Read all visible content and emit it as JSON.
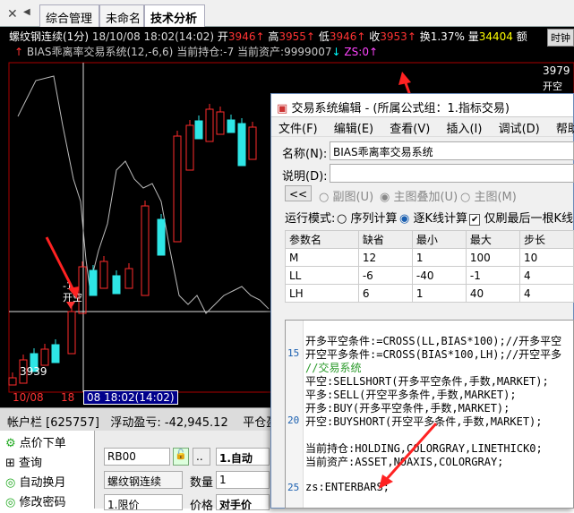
{
  "tabs": [
    "综合管理",
    "未命名",
    "技术分析"
  ],
  "chart": {
    "symbol": "螺纹钢连续(1分)",
    "datetime": "18/10/08 18:02(14:02)",
    "open_label": "开",
    "open": "3946",
    "high_label": "高",
    "high": "3955",
    "low_label": "低",
    "low": "3946",
    "close_label": "收",
    "close": "3953",
    "turnover_label": "换",
    "turnover": "1.37%",
    "volume_label": "量",
    "volume": "34404",
    "amount_label": "额",
    "time_button": "时钟",
    "indicator_line": "BIAS乖离率交易系统(12,-6,6)",
    "holding_label": "当前持仓:",
    "holding": "-7",
    "asset_label": "当前资产:",
    "asset": "9999007",
    "zs_label": "ZS:",
    "zs": "0",
    "price_top": "3979",
    "price_bottom": "3939",
    "signal_top": "开空",
    "signal_left_num": "-1",
    "signal_left": "开空",
    "axis_left": "10/08",
    "axis_mid": "18",
    "axis_cursor": "08 18:02(14:02)",
    "colors": {
      "up": "#ff2b2b",
      "down": "#2ee6e6",
      "bg": "#000000"
    }
  },
  "account_bar": {
    "label": "帐户栏",
    "account": "[625757]",
    "pnl_label": "浮动盈亏:",
    "pnl": "-42,945.12",
    "close_label": "平仓盈"
  },
  "left_menu": [
    "点价下单",
    "查询",
    "自动换月",
    "修改密码"
  ],
  "order": {
    "code": "RB00",
    "dots": "..",
    "mode": "1.自动",
    "name": "螺纹钢连续",
    "qty_label": "数量",
    "qty": "1",
    "price_type": "1.限价",
    "price_label": "价格",
    "price": "对手价"
  },
  "dialog": {
    "title": "交易系统编辑 - (所属公式组：1.指标交易)",
    "menus": [
      "文件(F)",
      "编辑(E)",
      "查看(V)",
      "插入(I)",
      "调试(D)",
      "帮助(H)"
    ],
    "name_label": "名称(N):",
    "name_value": "BIAS乖离率交易系统",
    "desc_label": "说明(D):",
    "back_button": "<<",
    "mode_fig": "副图(U)",
    "mode_overlay": "主图叠加(U)",
    "mode_main": "主图(M)",
    "run_label": "运行模式:",
    "run_seq": "序列计算",
    "run_bar": "逐K线计算",
    "refresh_last": "仅刷最后一根K线",
    "param_headers": [
      "参数名",
      "缺省",
      "最小",
      "最大",
      "步长"
    ],
    "params": [
      [
        "M",
        "12",
        "1",
        "100",
        "10"
      ],
      [
        "LL",
        "-6",
        "-40",
        "-1",
        "4"
      ],
      [
        "LH",
        "6",
        "1",
        "40",
        "4"
      ]
    ],
    "code_lines": [
      {
        "n": "",
        "t": "开多平空条件:=CROSS(LL,BIAS*100);//开多平空"
      },
      {
        "n": "15",
        "t": "开空平多条件:=CROSS(BIAS*100,LH);//开空平多"
      },
      {
        "n": "",
        "t": "//交易系统"
      },
      {
        "n": "",
        "t": "平空:SELLSHORT(开多平空条件,手数,MARKET);"
      },
      {
        "n": "",
        "t": "平多:SELL(开空平多条件,手数,MARKET);"
      },
      {
        "n": "",
        "t": "开多:BUY(开多平空条件,手数,MARKET);"
      },
      {
        "n": "20",
        "t": "开空:BUYSHORT(开空平多条件,手数,MARKET);"
      },
      {
        "n": "",
        "t": ""
      },
      {
        "n": "",
        "t": "当前持仓:HOLDING,COLORGRAY,LINETHICK0;"
      },
      {
        "n": "",
        "t": "当前资产:ASSET,NOAXIS,COLORGRAY;"
      },
      {
        "n": "",
        "t": ""
      },
      {
        "n": "25",
        "t": "zs:ENTERBARS;"
      }
    ]
  }
}
